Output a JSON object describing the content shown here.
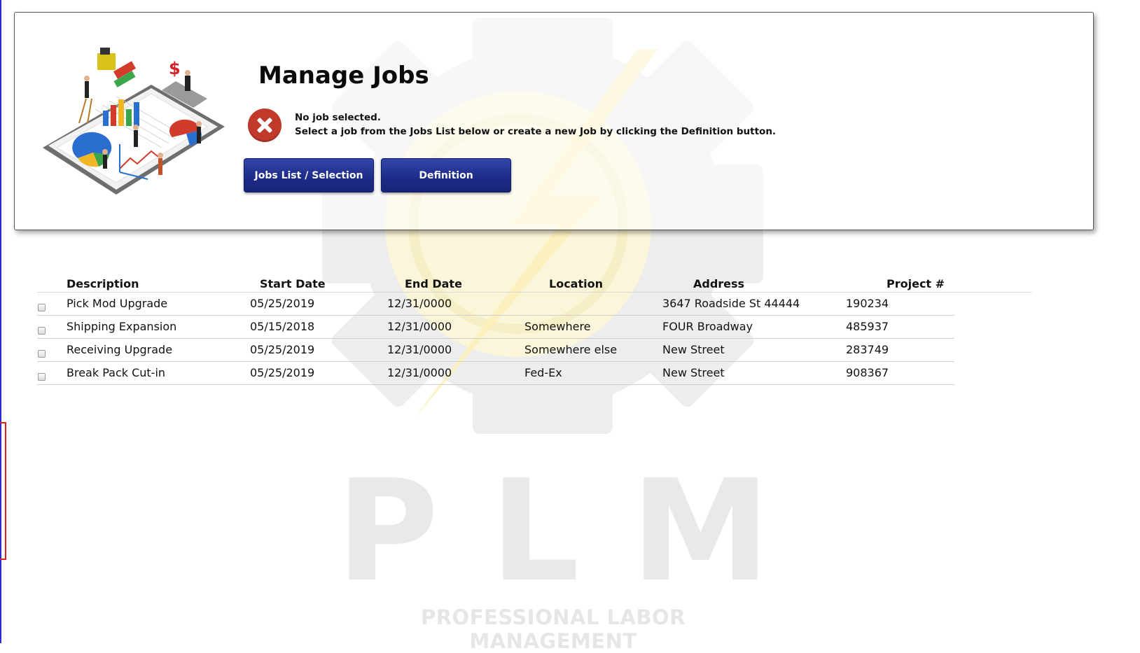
{
  "header": {
    "title": "Manage Jobs",
    "status_line1": "No job selected.",
    "status_line2": "Select a job from the Jobs List below or create a new Job by clicking the Definition button.",
    "jobs_list_label": "Jobs List / Selection",
    "definition_label": "Definition",
    "illustration_dollar_sign": "$"
  },
  "jobs_table": {
    "columns": [
      "Description",
      "Start Date",
      "End Date",
      "Location",
      "Address",
      "Project #"
    ],
    "rows": [
      {
        "description": "Pick Mod Upgrade",
        "start_date": "05/25/2019",
        "end_date": "12/31/0000",
        "location": "",
        "address": "3647 Roadside St 44444",
        "project": "190234"
      },
      {
        "description": "Shipping Expansion",
        "start_date": "05/15/2018",
        "end_date": "12/31/0000",
        "location": "Somewhere",
        "address": "FOUR Broadway",
        "project": "485937"
      },
      {
        "description": "Receiving Upgrade",
        "start_date": "05/25/2019",
        "end_date": "12/31/0000",
        "location": "Somewhere else",
        "address": "New Street",
        "project": "283749"
      },
      {
        "description": "Break Pack Cut-in",
        "start_date": "05/25/2019",
        "end_date": "12/31/0000",
        "location": "Fed-Ex",
        "address": "New Street",
        "project": "908367"
      }
    ]
  },
  "watermark": {
    "letters": [
      "P",
      "L",
      "M"
    ],
    "tagline": "PROFESSIONAL LABOR MANAGEMENT"
  },
  "colors": {
    "button_blue": "#1c2b86",
    "error_red": "#c0392b",
    "watermark_gray": "#e9e9e9",
    "watermark_yellow": "#fbf3c8"
  }
}
